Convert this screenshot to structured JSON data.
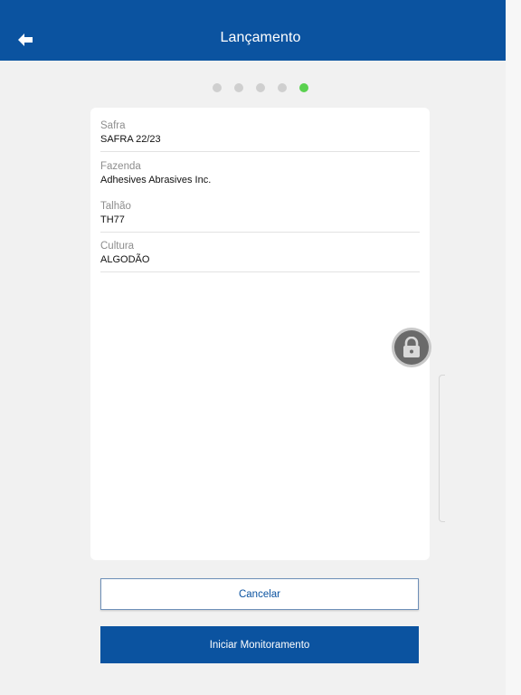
{
  "header": {
    "title": "Lançamento",
    "back_icon": "arrow-left-icon",
    "background": "#0b53a0"
  },
  "stepper": {
    "total": 5,
    "current": 5,
    "active_color": "#5ad14f"
  },
  "fields": [
    {
      "label": "Safra",
      "value": "SAFRA 22/23"
    },
    {
      "label": "Fazenda",
      "value": "Adhesives Abrasives Inc."
    },
    {
      "label": "Talhão",
      "value": "TH77"
    },
    {
      "label": "Cultura",
      "value": "ALGODÃO"
    }
  ],
  "floating": {
    "lock_icon": "lock-icon"
  },
  "actions": {
    "cancel_label": "Cancelar",
    "start_label": "Iniciar Monitoramento"
  }
}
